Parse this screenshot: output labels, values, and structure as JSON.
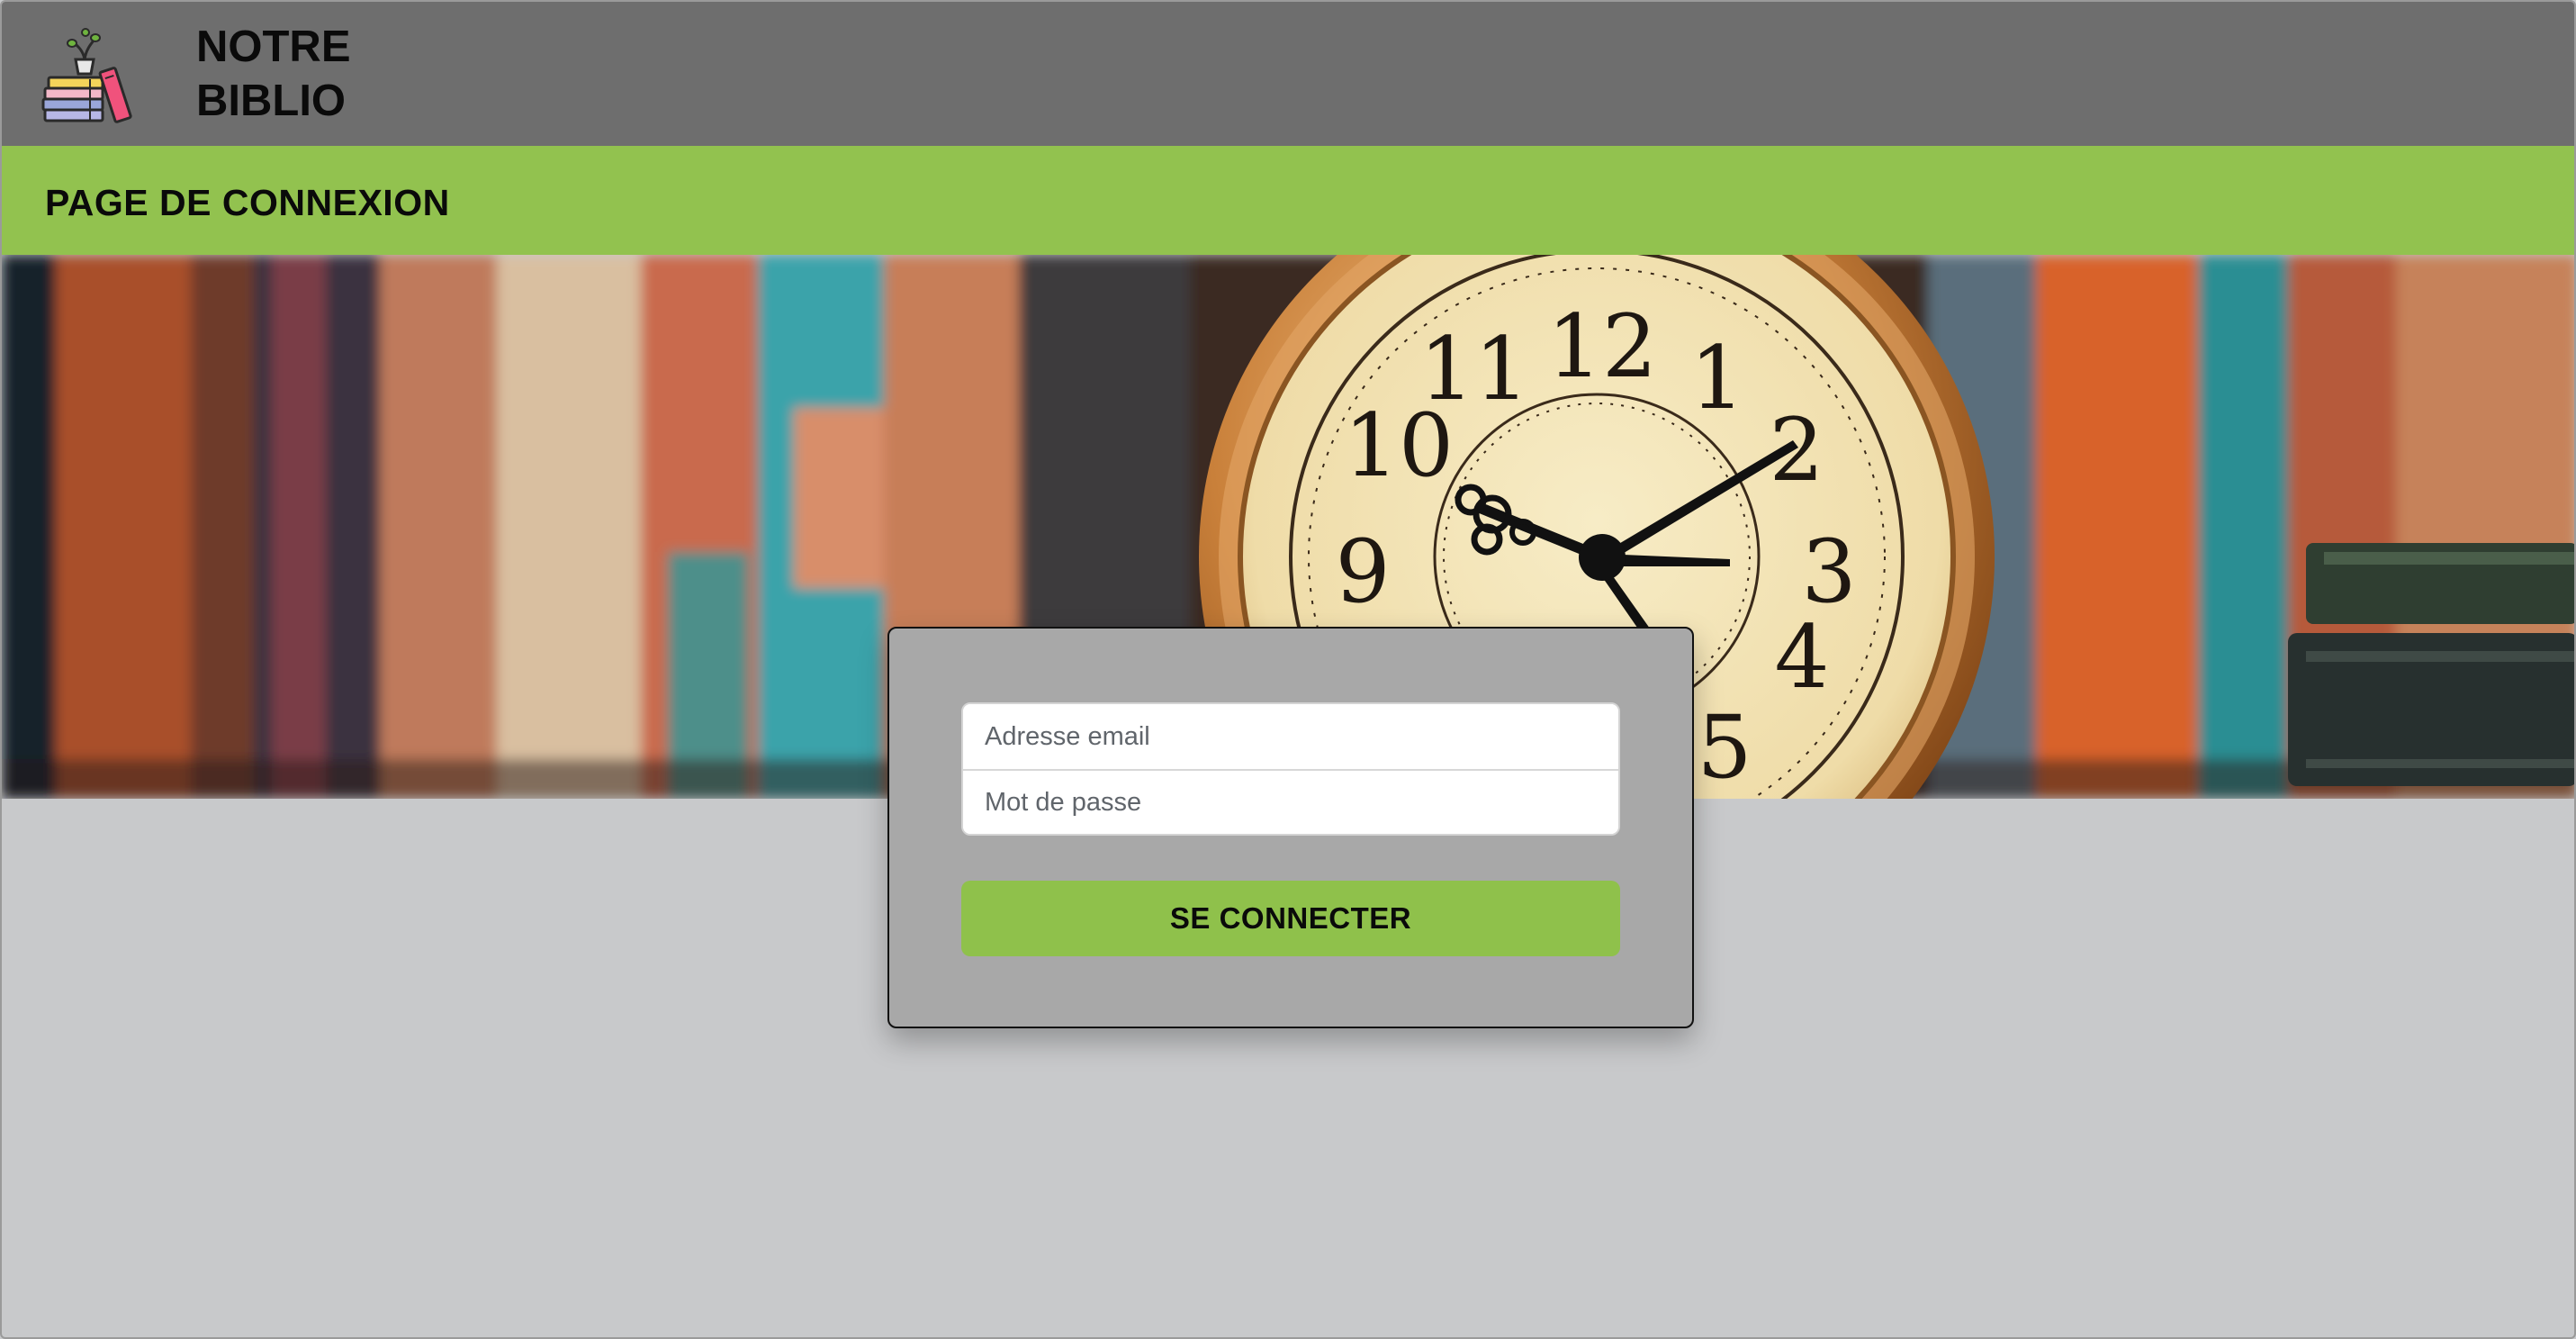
{
  "header": {
    "brand_line1": "NOTRE",
    "brand_line2": "BIBLIO",
    "logo_icon": "books-with-plant-icon",
    "background": "#6e6e6e"
  },
  "titlebar": {
    "title": "PAGE DE CONNEXION",
    "background": "#92c24f"
  },
  "hero": {
    "image": "bookshelf-with-clock-banner",
    "clock_numerals": [
      "12",
      "1",
      "2",
      "3",
      "4",
      "5",
      "9",
      "10",
      "11"
    ]
  },
  "login": {
    "email_placeholder": "Adresse email",
    "password_placeholder": "Mot de passe",
    "submit_label": "SE CONNECTER",
    "accent": "#8fc14b",
    "card_background": "#a8a8a8"
  },
  "page": {
    "background": "#c8c9cb"
  }
}
